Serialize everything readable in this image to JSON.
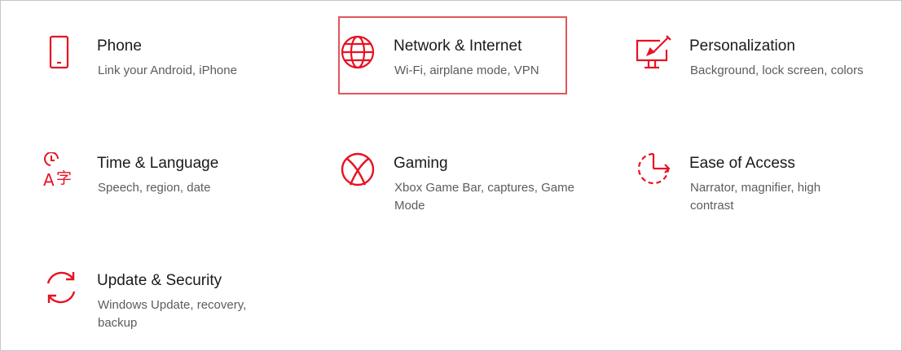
{
  "accent_color": "#e81123",
  "highlight_color": "#e0565b",
  "tiles": [
    {
      "icon": "phone-icon",
      "title": "Phone",
      "desc": "Link your Android, iPhone"
    },
    {
      "icon": "globe-icon",
      "title": "Network & Internet",
      "desc": "Wi-Fi, airplane mode, VPN",
      "highlighted": true
    },
    {
      "icon": "personalization-icon",
      "title": "Personalization",
      "desc": "Background, lock screen, colors"
    },
    {
      "icon": "time-language-icon",
      "title": "Time & Language",
      "desc": "Speech, region, date"
    },
    {
      "icon": "xbox-icon",
      "title": "Gaming",
      "desc": "Xbox Game Bar, captures, Game Mode"
    },
    {
      "icon": "ease-of-access-icon",
      "title": "Ease of Access",
      "desc": "Narrator, magnifier, high contrast"
    },
    {
      "icon": "update-security-icon",
      "title": "Update & Security",
      "desc": "Windows Update, recovery, backup"
    }
  ]
}
